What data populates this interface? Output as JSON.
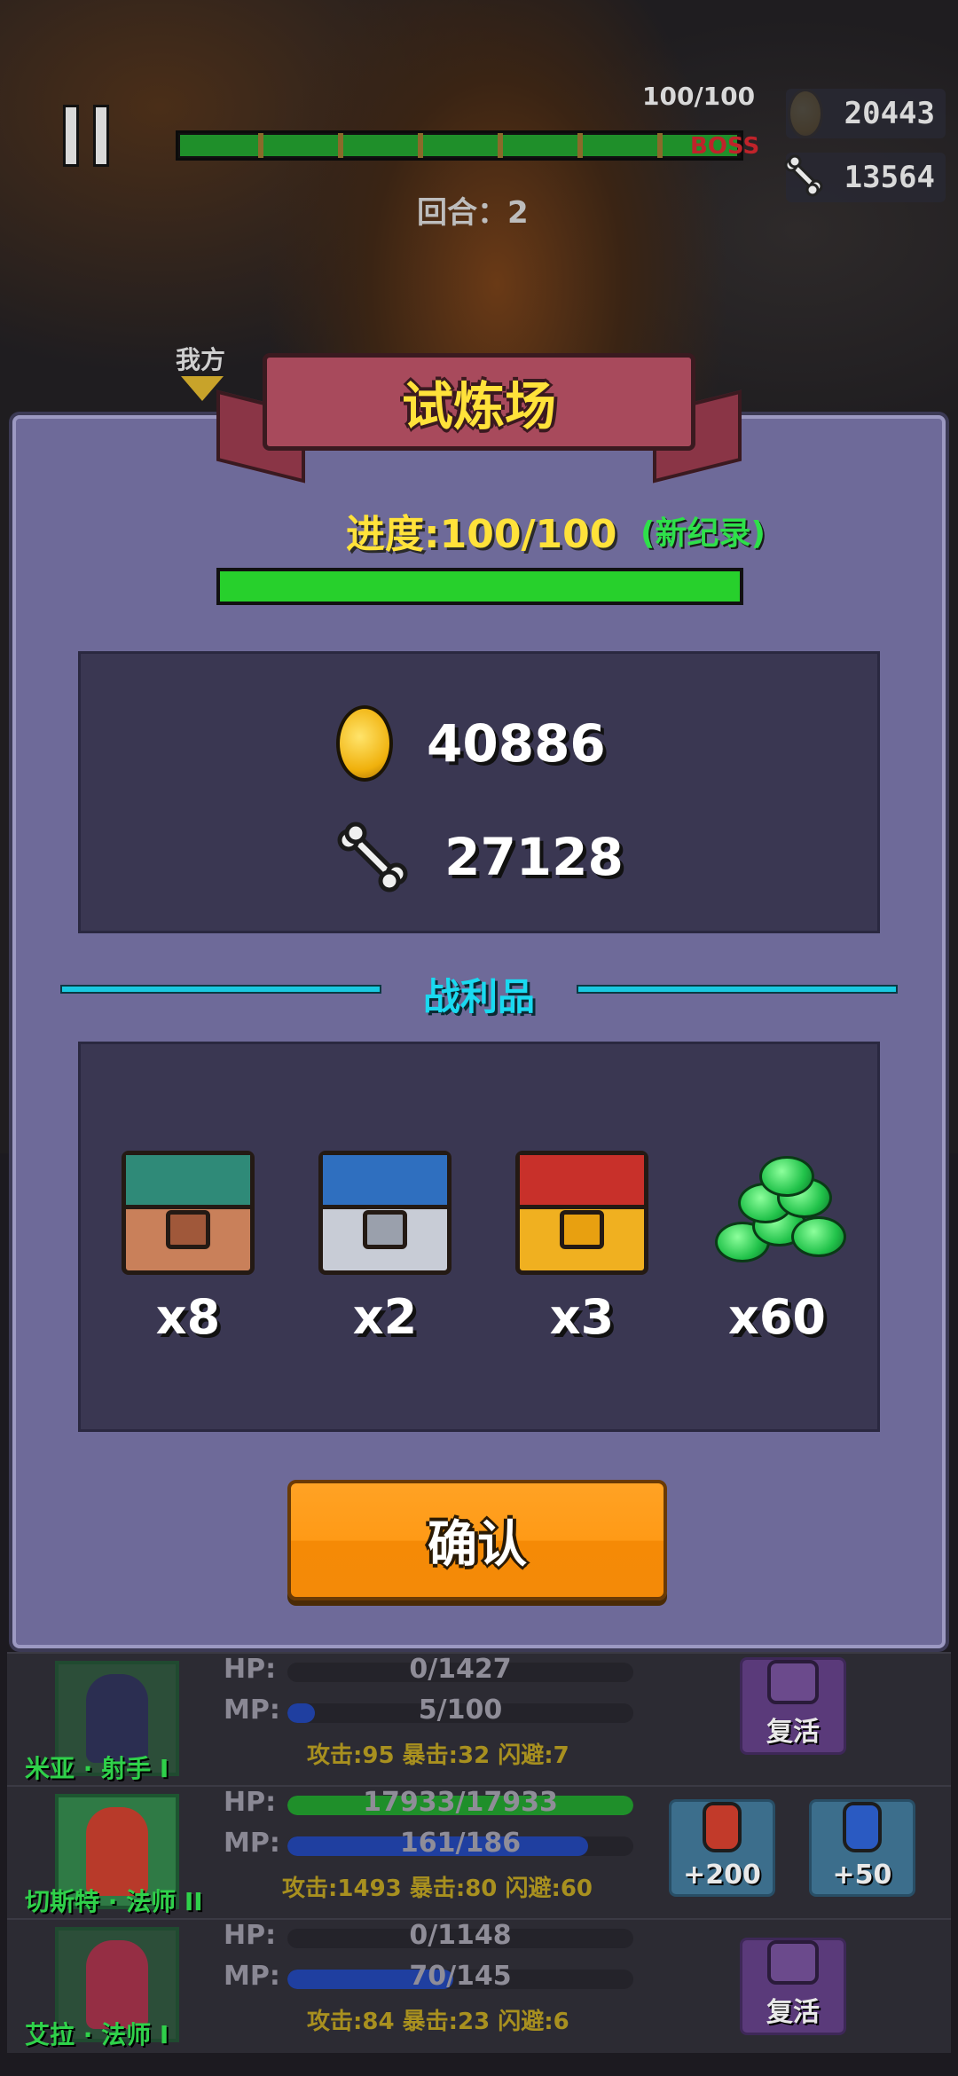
{
  "hud": {
    "boss_hp": "100/100",
    "boss_label": "BOSS",
    "round_label": "回合：2",
    "gold": "20443",
    "bones": "13564",
    "ally_tag": "我方"
  },
  "modal": {
    "title": "试炼场",
    "progress_label": "进度:100/100",
    "progress_value": 1.0,
    "new_record": "(新纪录)",
    "rewards": {
      "gold": "40886",
      "bones": "27128"
    },
    "loot_title": "战利品",
    "loot": [
      {
        "icon": "bronze-chest-icon",
        "count": "x8"
      },
      {
        "icon": "silver-chest-icon",
        "count": "x2"
      },
      {
        "icon": "gold-chest-icon",
        "count": "x3"
      },
      {
        "icon": "emerald-pile-icon",
        "count": "x60"
      }
    ],
    "confirm_label": "确认"
  },
  "heroes": [
    {
      "name": "米亚 · 射手 I",
      "hp_label": "HP:",
      "hp": "0/1427",
      "hp_ratio": 0.0,
      "mp_label": "MP:",
      "mp": "5/100",
      "mp_ratio": 0.05,
      "stats": "攻击:95 暴击:32 闪避:7",
      "actions": [
        {
          "type": "revive",
          "label": "复活"
        }
      ]
    },
    {
      "name": "切斯特 · 法师 II",
      "hp_label": "HP:",
      "hp": "17933/17933",
      "hp_ratio": 1.0,
      "mp_label": "MP:",
      "mp": "161/186",
      "mp_ratio": 0.87,
      "stats": "攻击:1493 暴击:80 闪避:60",
      "actions": [
        {
          "type": "hp-potion",
          "label": "+200"
        },
        {
          "type": "mp-potion",
          "label": "+50"
        }
      ]
    },
    {
      "name": "艾拉 · 法师 I",
      "hp_label": "HP:",
      "hp": "0/1148",
      "hp_ratio": 0.0,
      "mp_label": "MP:",
      "mp": "70/145",
      "mp_ratio": 0.48,
      "stats": "攻击:84 暴击:23 闪避:6",
      "actions": [
        {
          "type": "revive",
          "label": "复活"
        }
      ]
    }
  ],
  "colors": {
    "modal_bg": "#6e6a99",
    "title_yellow": "#ffe23a",
    "record_green": "#2ee04a",
    "progress_green": "#27d02c",
    "accent_cyan": "#19d9f0",
    "button_orange": "#ff9a16",
    "hp_green": "#1f8f2a",
    "mp_blue": "#1f3fa0"
  }
}
